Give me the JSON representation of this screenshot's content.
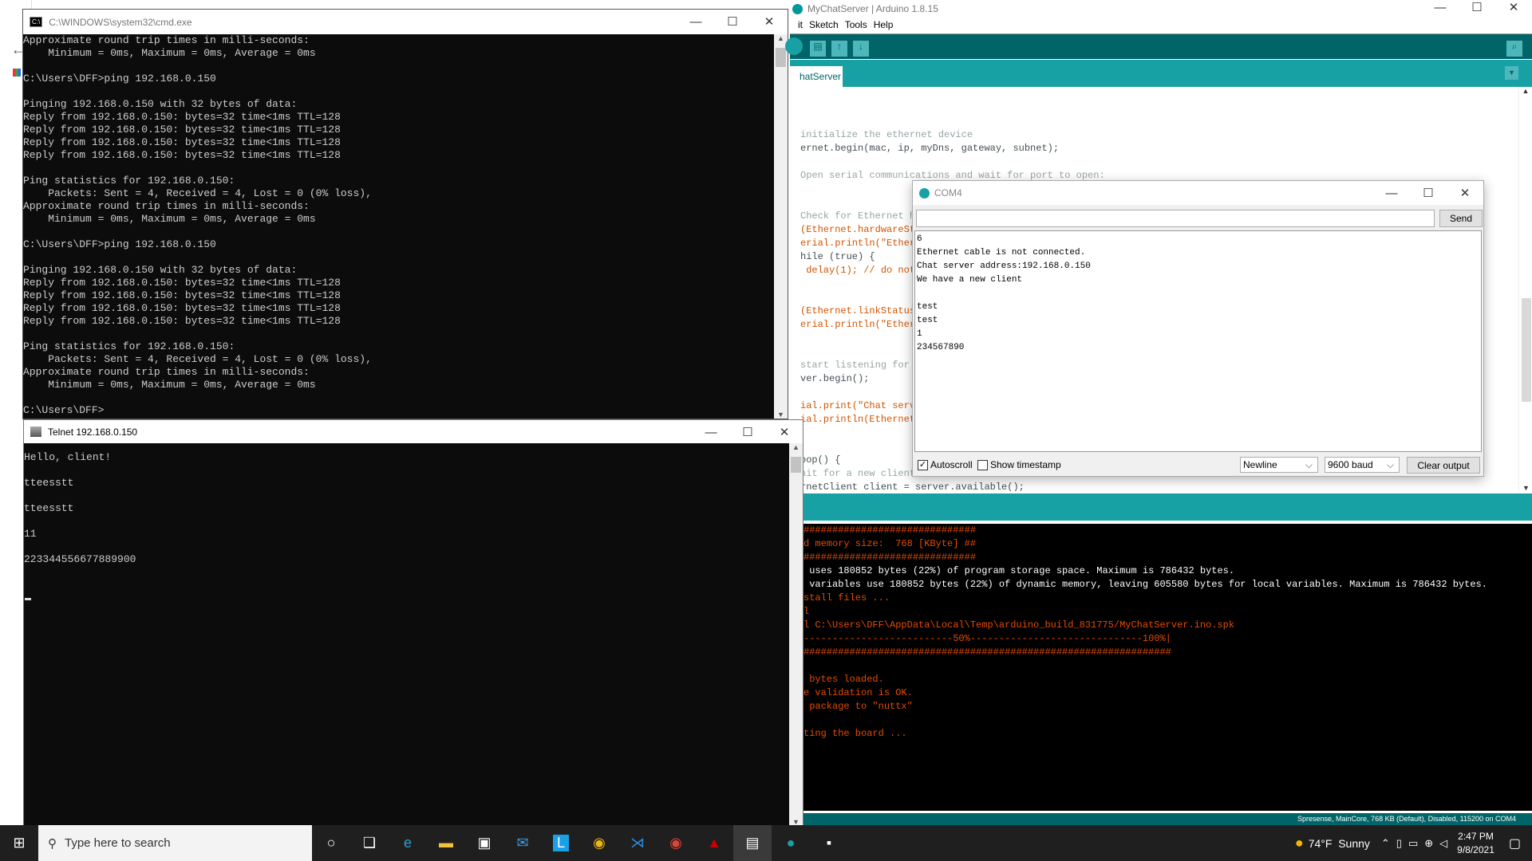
{
  "cmd": {
    "title": "C:\\WINDOWS\\system32\\cmd.exe",
    "lines": [
      "Approximate round trip times in milli-seconds:",
      "    Minimum = 0ms, Maximum = 0ms, Average = 0ms",
      "",
      "C:\\Users\\DFF>ping 192.168.0.150",
      "",
      "Pinging 192.168.0.150 with 32 bytes of data:",
      "Reply from 192.168.0.150: bytes=32 time<1ms TTL=128",
      "Reply from 192.168.0.150: bytes=32 time<1ms TTL=128",
      "Reply from 192.168.0.150: bytes=32 time<1ms TTL=128",
      "Reply from 192.168.0.150: bytes=32 time<1ms TTL=128",
      "",
      "Ping statistics for 192.168.0.150:",
      "    Packets: Sent = 4, Received = 4, Lost = 0 (0% loss),",
      "Approximate round trip times in milli-seconds:",
      "    Minimum = 0ms, Maximum = 0ms, Average = 0ms",
      "",
      "C:\\Users\\DFF>ping 192.168.0.150",
      "",
      "Pinging 192.168.0.150 with 32 bytes of data:",
      "Reply from 192.168.0.150: bytes=32 time<1ms TTL=128",
      "Reply from 192.168.0.150: bytes=32 time<1ms TTL=128",
      "Reply from 192.168.0.150: bytes=32 time<1ms TTL=128",
      "Reply from 192.168.0.150: bytes=32 time<1ms TTL=128",
      "",
      "Ping statistics for 192.168.0.150:",
      "    Packets: Sent = 4, Received = 4, Lost = 0 (0% loss),",
      "Approximate round trip times in milli-seconds:",
      "    Minimum = 0ms, Maximum = 0ms, Average = 0ms",
      "",
      "C:\\Users\\DFF>"
    ]
  },
  "telnet": {
    "title": "Telnet 192.168.0.150",
    "lines": [
      "Hello, client!",
      "",
      "tteesstt",
      "",
      "tteesstt",
      "",
      "11",
      "",
      "223344556677889900"
    ]
  },
  "arduino": {
    "title": "MyChatServer | Arduino 1.8.15",
    "menu": [
      "it",
      "Sketch",
      "Tools",
      "Help"
    ],
    "tab": "hatServer",
    "code": [
      [
        "cm",
        "initialize the ethernet device"
      ],
      [
        "mix",
        "ernet.begin(mac, ip, myDns, gateway, subnet);"
      ],
      [
        "",
        ""
      ],
      [
        "cm",
        "Open serial communications and wait for port to open:"
      ],
      [
        "",
        ""
      ],
      [
        "",
        ""
      ],
      [
        "cm",
        "Check for Ethernet h"
      ],
      [
        "kw",
        "(Ethernet.hardwareSt"
      ],
      [
        "kw",
        "erial.println(\"Ether"
      ],
      [
        "mix",
        "hile (true) {"
      ],
      [
        "kw",
        " delay(1); // do not"
      ],
      [
        "",
        ""
      ],
      [
        "",
        ""
      ],
      [
        "kw",
        "(Ethernet.linkStatus"
      ],
      [
        "kw",
        "erial.println(\"Ether"
      ],
      [
        "",
        ""
      ],
      [
        "",
        ""
      ],
      [
        "cm",
        "start listening for"
      ],
      [
        "mix",
        "ver.begin();"
      ],
      [
        "",
        ""
      ],
      [
        "kw",
        "ial.print(\"Chat serv"
      ],
      [
        "kw",
        "ial.println(Ethernet"
      ],
      [
        "",
        ""
      ],
      [
        "",
        ""
      ],
      [
        "mix",
        "oop() {"
      ],
      [
        "cm",
        "ait for a new client:"
      ],
      [
        "mix",
        "rnetClient client = server.available();"
      ]
    ],
    "console": [
      [
        "o",
        "##############################"
      ],
      [
        "o",
        "d memory size:  768 [KByte] ##"
      ],
      [
        "o",
        "##############################"
      ],
      [
        "w",
        " uses 180852 bytes (22%) of program storage space. Maximum is 786432 bytes."
      ],
      [
        "w",
        " variables use 180852 bytes (22%) of dynamic memory, leaving 605580 bytes for local variables. Maximum is 786432 bytes."
      ],
      [
        "o",
        "stall files ..."
      ],
      [
        "o",
        "l"
      ],
      [
        "o",
        "l C:\\Users\\DFF\\AppData\\Local\\Temp\\arduino_build_831775/MyChatServer.ino.spk"
      ],
      [
        "o",
        "--------------------------50%------------------------------100%|"
      ],
      [
        "o",
        "################################################################"
      ],
      [
        "o",
        ""
      ],
      [
        "o",
        " bytes loaded."
      ],
      [
        "o",
        "e validation is OK."
      ],
      [
        "o",
        " package to \"nuttx\""
      ],
      [
        "o",
        ""
      ],
      [
        "o",
        "ting the board ..."
      ]
    ],
    "status": "Spresense, MainCore, 768 KB (Default), Disabled, 115200 on COM4"
  },
  "serial_monitor": {
    "title": "COM4",
    "input_value": "",
    "send": "Send",
    "lines": [
      "6",
      "Ethernet cable is not connected.",
      "Chat server address:192.168.0.150",
      "We have a new client",
      "",
      "test",
      "test",
      "1",
      "234567890"
    ],
    "autoscroll": "Autoscroll",
    "autoscroll_checked": true,
    "timestamp": "Show timestamp",
    "timestamp_checked": false,
    "line_ending": "Newline",
    "baud": "9600 baud",
    "clear": "Clear output"
  },
  "taskbar": {
    "search_placeholder": "Type here to search",
    "weather": "74°F  Sunny",
    "time": "2:47 PM",
    "date": "9/8/2021"
  },
  "colors": {
    "arduino_dark": "#006468",
    "arduino_teal": "#17a1a5",
    "console_orange": "#e34c00"
  }
}
